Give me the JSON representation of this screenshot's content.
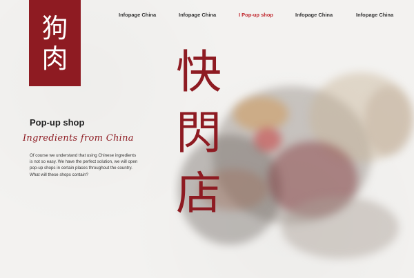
{
  "logo": {
    "chars": [
      "狗",
      "肉"
    ]
  },
  "nav": {
    "items": [
      {
        "label": "Infopage China",
        "active": false
      },
      {
        "label": "Infopage China",
        "active": false
      },
      {
        "label": "I Pop-up shop",
        "active": true
      },
      {
        "label": "Infopage China",
        "active": false
      },
      {
        "label": "Infopage China",
        "active": false
      }
    ]
  },
  "hero": {
    "chars": [
      "快",
      "閃",
      "店"
    ]
  },
  "section": {
    "title": "Pop-up shop",
    "subtitle": "Ingredients from China",
    "body": "Of course we understand that using Chinese ingredients is not so easy. We have the perfect solution, we will open pop-up shops in certain places throughout the country. What will these shops contain?"
  },
  "colors": {
    "brand_red": "#8e1b22",
    "nav_active": "#c0272d"
  }
}
